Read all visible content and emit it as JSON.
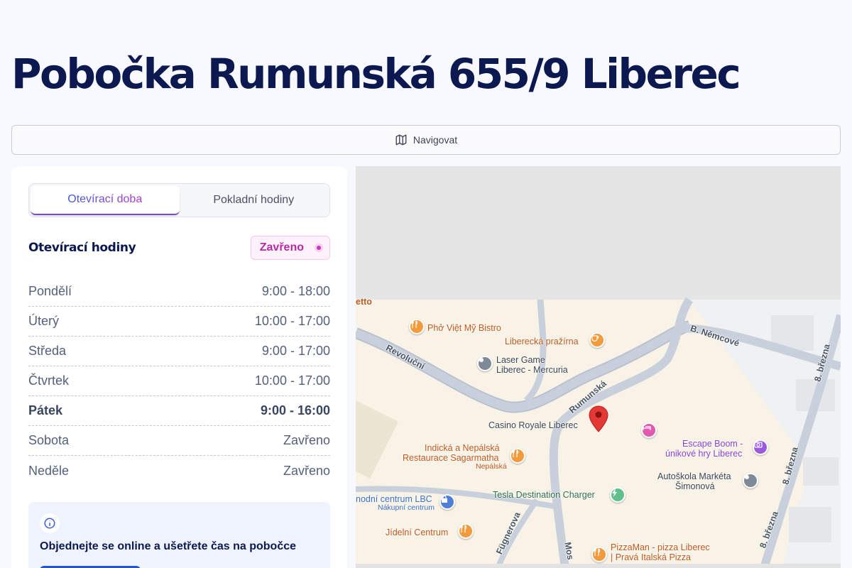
{
  "page": {
    "title": "Pobočka Rumunská 655/9 Liberec",
    "navigate_label": "Navigovat"
  },
  "tabs": [
    {
      "label": "Otevírací doba",
      "active": true
    },
    {
      "label": "Pokladní hodiny",
      "active": false
    }
  ],
  "hours": {
    "title": "Otevírací hodiny",
    "status": "Zavřeno",
    "rows": [
      {
        "day": "Pondělí",
        "time": "9:00 - 18:00",
        "today": false
      },
      {
        "day": "Úterý",
        "time": "10:00 - 17:00",
        "today": false
      },
      {
        "day": "Středa",
        "time": "9:00 - 17:00",
        "today": false
      },
      {
        "day": "Čtvrtek",
        "time": "10:00 - 17:00",
        "today": false
      },
      {
        "day": "Pátek",
        "time": "9:00 - 16:00",
        "today": true
      },
      {
        "day": "Sobota",
        "time": "Zavřeno",
        "today": false
      },
      {
        "day": "Neděle",
        "time": "Zavřeno",
        "today": false
      }
    ]
  },
  "promo": {
    "text": "Objednejte se online a ušetřete čas na pobočce"
  },
  "map": {
    "streets": [
      "Revoluční",
      "Rumunská",
      "B. Němcové",
      "8. března",
      "8. března",
      "8. března",
      "Fügnerova",
      "Mos",
      "etto"
    ],
    "pois": [
      {
        "name": "Phở Việt Mỹ Bistro",
        "icon": "restaurant-icon"
      },
      {
        "name": "Liberecká pražírna",
        "icon": "cafe-icon"
      },
      {
        "name": "Laser Game",
        "name2": "Liberec - Mercuria",
        "icon": "place-icon"
      },
      {
        "name": "Casino Royale Liberec",
        "icon": "place-icon"
      },
      {
        "name": "Indická a Nepálská",
        "name2": "Restaurace Sagarmatha",
        "sub": "Nepálská",
        "icon": "restaurant-icon"
      },
      {
        "name": "Escape Boom -",
        "name2": "únikové hry Liberec",
        "icon": "camera-icon"
      },
      {
        "name": "Autoškola Markéta",
        "name2": "Šimonová",
        "icon": "place-icon"
      },
      {
        "name": "nodní centrum LBC",
        "sub": "Nákupní centrum",
        "icon": "shopping-icon"
      },
      {
        "name": "Tesla Destination Charger",
        "icon": "charging-icon"
      },
      {
        "name": "Jídelní Centrum",
        "icon": "restaurant-icon"
      },
      {
        "name": "PizzaMan - pizza Liberec",
        "name2": "| Pravá Italská Pizza",
        "icon": "restaurant-icon"
      }
    ]
  },
  "colors": {
    "title": "#0c1850",
    "accent_gradient_start": "#3a5bdc",
    "accent_gradient_end": "#b63ad1",
    "status_closed": "#b62aa4",
    "marker": "#e53935"
  }
}
